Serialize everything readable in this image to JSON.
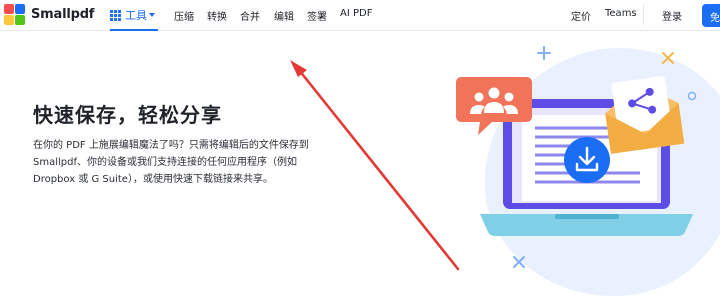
{
  "brand": {
    "name": "Smallpdf"
  },
  "nav": {
    "tools_label": "工具",
    "links": [
      "压缩",
      "转换",
      "合并",
      "编辑",
      "签署",
      "AI PDF"
    ],
    "right": {
      "pricing": "定价",
      "teams": "Teams",
      "login": "登录",
      "cta_partial": "免"
    }
  },
  "hero": {
    "title": "快速保存，轻松分享",
    "lines": [
      "在你的 PDF 上施展编辑魔法了吗？只需将编辑后的文件保存到",
      "Smallpdf、你的设备或我们支持连接的任何应用程序（例如",
      "Dropbox 或 G Suite），或使用快速下载链接来共享。"
    ]
  },
  "colors": {
    "accent": "#1b6ef3",
    "arrow": "#e53935",
    "bubble": "#f0735a",
    "laptop": "#5c4ee5",
    "laptop_base": "#7fd0e6",
    "envelope": "#f6c06b",
    "blob": "#e8f1fd"
  },
  "icons": {
    "logo": "smallpdf-logo-icon",
    "tools": "grid-icon",
    "caret": "chevron-down-icon",
    "illustration": [
      "people-icon",
      "share-icon",
      "download-icon",
      "sparkle-icon"
    ]
  }
}
